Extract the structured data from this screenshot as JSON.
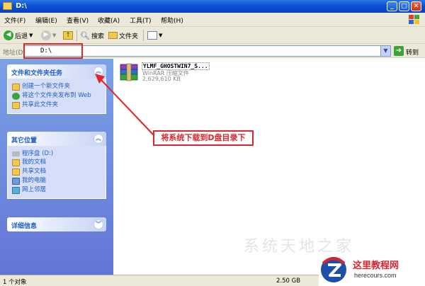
{
  "window": {
    "title": "D:\\"
  },
  "menu": [
    "文件(F)",
    "编辑(E)",
    "查看(V)",
    "收藏(A)",
    "工具(T)",
    "帮助(H)"
  ],
  "toolbar": {
    "back_label": "后退",
    "search_label": "搜索",
    "folders_label": "文件夹"
  },
  "address": {
    "label": "地址(D)",
    "value": "D:\\",
    "go_label": "转到"
  },
  "panels": {
    "tasks": {
      "title": "文件和文件夹任务",
      "items": [
        "创建一个新文件夹",
        "将这个文件夹发布到 Web",
        "共享此文件夹"
      ]
    },
    "places": {
      "title": "其它位置",
      "items": [
        "程序盘 (D:)",
        "我的文档",
        "共享文档",
        "我的电脑",
        "网上邻居"
      ]
    },
    "details": {
      "title": "详细信息"
    }
  },
  "file": {
    "name": "YLMF_GHOSTWIN7_S...",
    "type": "WinRAR 压缩文件",
    "size": "2,629,610 KB"
  },
  "annotation": "将系统下载到D盘目录下",
  "status": {
    "objects": "1 个对象",
    "size": "2.50 GB"
  },
  "watermark": "系统天地之家",
  "site": {
    "name": "这里教程网",
    "url": "herecours.com"
  },
  "colors": {
    "titlebar": "#0a4fd2",
    "pane": "#6375d6",
    "accent": "#e0262c"
  }
}
